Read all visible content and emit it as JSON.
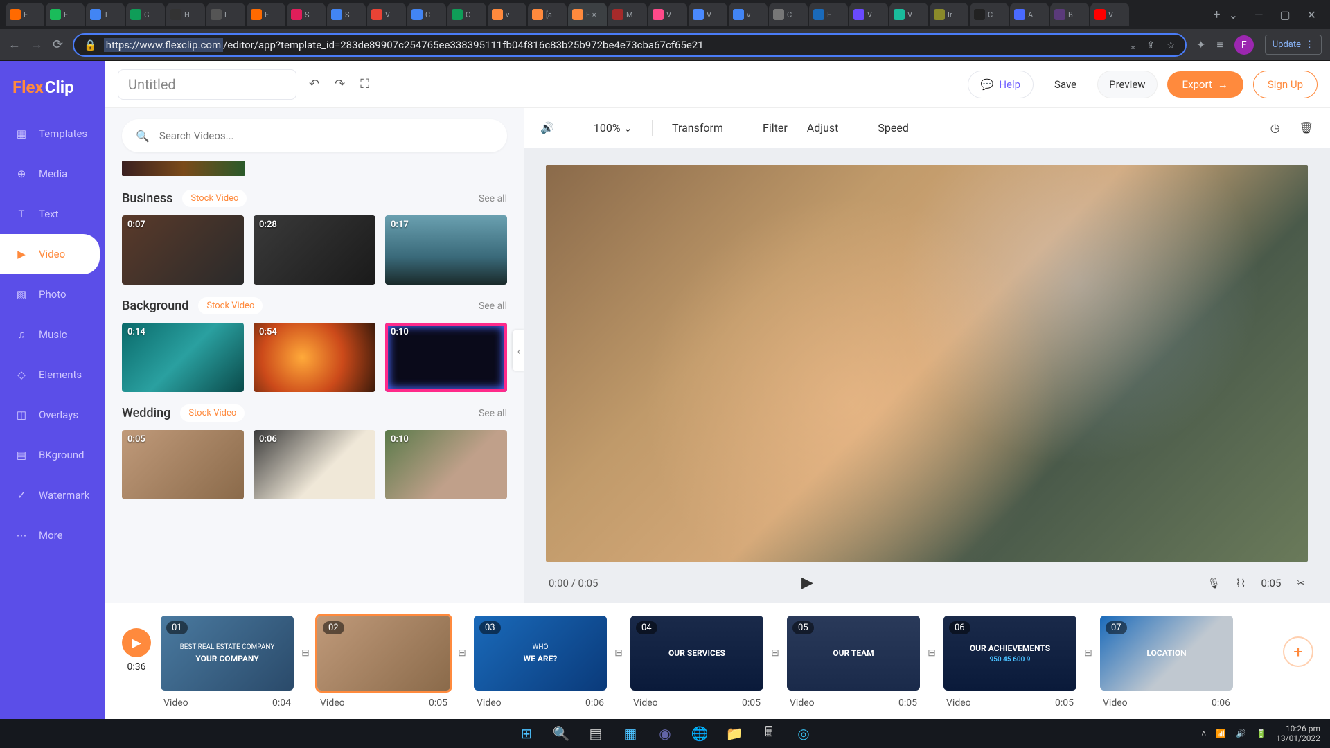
{
  "browser": {
    "tabs": [
      {
        "label": "F",
        "color": "#ff6a00"
      },
      {
        "label": "F",
        "color": "#1abc5a"
      },
      {
        "label": "T",
        "color": "#4285f4"
      },
      {
        "label": "G",
        "color": "#0f9d58"
      },
      {
        "label": "H",
        "color": "#333"
      },
      {
        "label": "L",
        "color": "#555"
      },
      {
        "label": "F",
        "color": "#ff6a00"
      },
      {
        "label": "S",
        "color": "#e01e5a"
      },
      {
        "label": "S",
        "color": "#4285f4"
      },
      {
        "label": "V",
        "color": "#ea4335"
      },
      {
        "label": "C",
        "color": "#4285f4"
      },
      {
        "label": "C",
        "color": "#0f9d58"
      },
      {
        "label": "v",
        "color": "#ff8a3d"
      },
      {
        "label": "[a",
        "color": "#ff8a3d"
      },
      {
        "label": "F ×",
        "color": "#ff8a3d",
        "active": true
      },
      {
        "label": "M",
        "color": "#a52a2a"
      },
      {
        "label": "V",
        "color": "#ff4a8a"
      },
      {
        "label": "V",
        "color": "#4a8aff"
      },
      {
        "label": "v",
        "color": "#4285f4"
      },
      {
        "label": "C",
        "color": "#777"
      },
      {
        "label": "F",
        "color": "#1a6aba"
      },
      {
        "label": "V",
        "color": "#6a4aff"
      },
      {
        "label": "V",
        "color": "#1abc9c"
      },
      {
        "label": "Ir",
        "color": "#8a8a2a"
      },
      {
        "label": "C",
        "color": "#222"
      },
      {
        "label": "A",
        "color": "#4a6aff"
      },
      {
        "label": "B",
        "color": "#5a3a7a"
      },
      {
        "label": "V",
        "color": "#ff0000"
      }
    ],
    "url": "https://www.flexclip.com/editor/app?template_id=283de89907c254765ee338395111fb04f816c83b25b972be4e73cba67cf65e21",
    "url_host": "https://www.flexclip.com",
    "update": "Update",
    "avatar": "F"
  },
  "app": {
    "logo_a": "Flex",
    "logo_b": "Clip",
    "title": "Untitled",
    "sidebar": [
      {
        "label": "Templates",
        "icon": "▦"
      },
      {
        "label": "Media",
        "icon": "⊕"
      },
      {
        "label": "Text",
        "icon": "T"
      },
      {
        "label": "Video",
        "icon": "▶",
        "active": true
      },
      {
        "label": "Photo",
        "icon": "▧"
      },
      {
        "label": "Music",
        "icon": "♫"
      },
      {
        "label": "Elements",
        "icon": "◇"
      },
      {
        "label": "Overlays",
        "icon": "◫"
      },
      {
        "label": "BKground",
        "icon": "▤"
      },
      {
        "label": "Watermark",
        "icon": "✓"
      },
      {
        "label": "More",
        "icon": "⋯"
      }
    ],
    "topbar": {
      "help": "Help",
      "save": "Save",
      "preview": "Preview",
      "export": "Export",
      "signup": "Sign Up"
    },
    "panel": {
      "search_ph": "Search Videos...",
      "see_all": "See all",
      "stock_video": "Stock Video",
      "cats": [
        {
          "title": "Business",
          "thumbs": [
            {
              "dur": "0:07",
              "bg": "bg-biz1"
            },
            {
              "dur": "0:28",
              "bg": "bg-biz2"
            },
            {
              "dur": "0:17",
              "bg": "bg-biz3"
            }
          ]
        },
        {
          "title": "Background",
          "thumbs": [
            {
              "dur": "0:14",
              "bg": "bg-bg1"
            },
            {
              "dur": "0:54",
              "bg": "bg-bg2"
            },
            {
              "dur": "0:10",
              "bg": "bg-bg3"
            }
          ]
        },
        {
          "title": "Wedding",
          "thumbs": [
            {
              "dur": "0:05",
              "bg": "bg-wed1"
            },
            {
              "dur": "0:06",
              "bg": "bg-wed2"
            },
            {
              "dur": "0:10",
              "bg": "bg-wed3"
            }
          ]
        }
      ]
    },
    "preview": {
      "zoom": "100%",
      "actions": {
        "transform": "Transform",
        "filter": "Filter",
        "adjust": "Adjust",
        "speed": "Speed"
      },
      "time_left": "0:00 / 0:05",
      "time_right": "0:05"
    },
    "timeline": {
      "total": "0:36",
      "label": "Video",
      "clips": [
        {
          "num": "01",
          "dur": "0:04",
          "bg": "bg-c1",
          "txt1": "BEST REAL ESTATE COMPANY",
          "txt2": "YOUR COMPANY"
        },
        {
          "num": "02",
          "dur": "0:05",
          "bg": "bg-c2",
          "selected": true
        },
        {
          "num": "03",
          "dur": "0:06",
          "bg": "bg-c3",
          "txt1": "WHO",
          "txt2": "WE ARE?"
        },
        {
          "num": "04",
          "dur": "0:05",
          "bg": "bg-c4",
          "txt2": "OUR SERVICES"
        },
        {
          "num": "05",
          "dur": "0:05",
          "bg": "bg-c5",
          "txt2": "OUR TEAM"
        },
        {
          "num": "06",
          "dur": "0:05",
          "bg": "bg-c6",
          "txt2": "OUR ACHIEVEMENTS",
          "nums": "950  45  600  9"
        },
        {
          "num": "07",
          "dur": "0:06",
          "bg": "bg-c7",
          "txt2": "LOCATION"
        }
      ]
    }
  },
  "taskbar": {
    "time": "10:26 pm",
    "date": "13/01/2022"
  }
}
